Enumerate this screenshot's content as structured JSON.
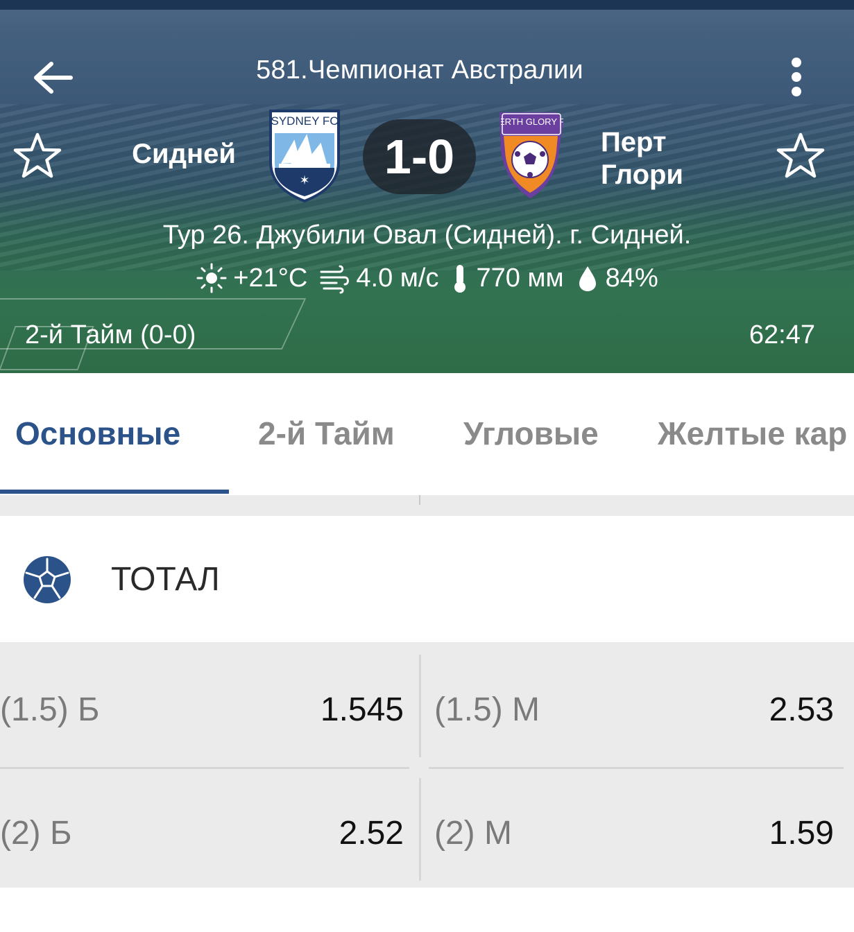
{
  "header": {
    "league_title": "581.Чемпионат Австралии",
    "home_team": "Сидней",
    "away_team": "Перт Глори",
    "home_logo_text": "SYDNEY FC",
    "away_logo_text": "PERTH GLORY FC",
    "score": "1-0",
    "venue": "Тур 26. Джубили Овал (Сидней). г. Сидней.",
    "weather": {
      "temperature": "+21°C",
      "wind": "4.0 м/с",
      "pressure": "770 мм",
      "humidity": "84%"
    },
    "period": "2-й  Тайм (0-0)",
    "clock": "62:47"
  },
  "tabs": [
    {
      "label": "Основные",
      "active": true
    },
    {
      "label": "2-й  Тайм",
      "active": false
    },
    {
      "label": "Угловые",
      "active": false
    },
    {
      "label": "Желтые кар",
      "active": false
    }
  ],
  "market": {
    "title": "ТОТАЛ",
    "rows": [
      {
        "over_label": "(1.5) Б",
        "over_value": "1.545",
        "under_label": "(1.5) М",
        "under_value": "2.53"
      },
      {
        "over_label": "(2) Б",
        "over_value": "2.52",
        "under_label": "(2) М",
        "under_value": "1.59"
      }
    ]
  },
  "colors": {
    "accent": "#2b5389",
    "header_overlay": "#1d3555",
    "away_team_purple": "#6b3fa0",
    "away_team_orange": "#f08a24",
    "home_team_sky": "#7fb8e6"
  }
}
